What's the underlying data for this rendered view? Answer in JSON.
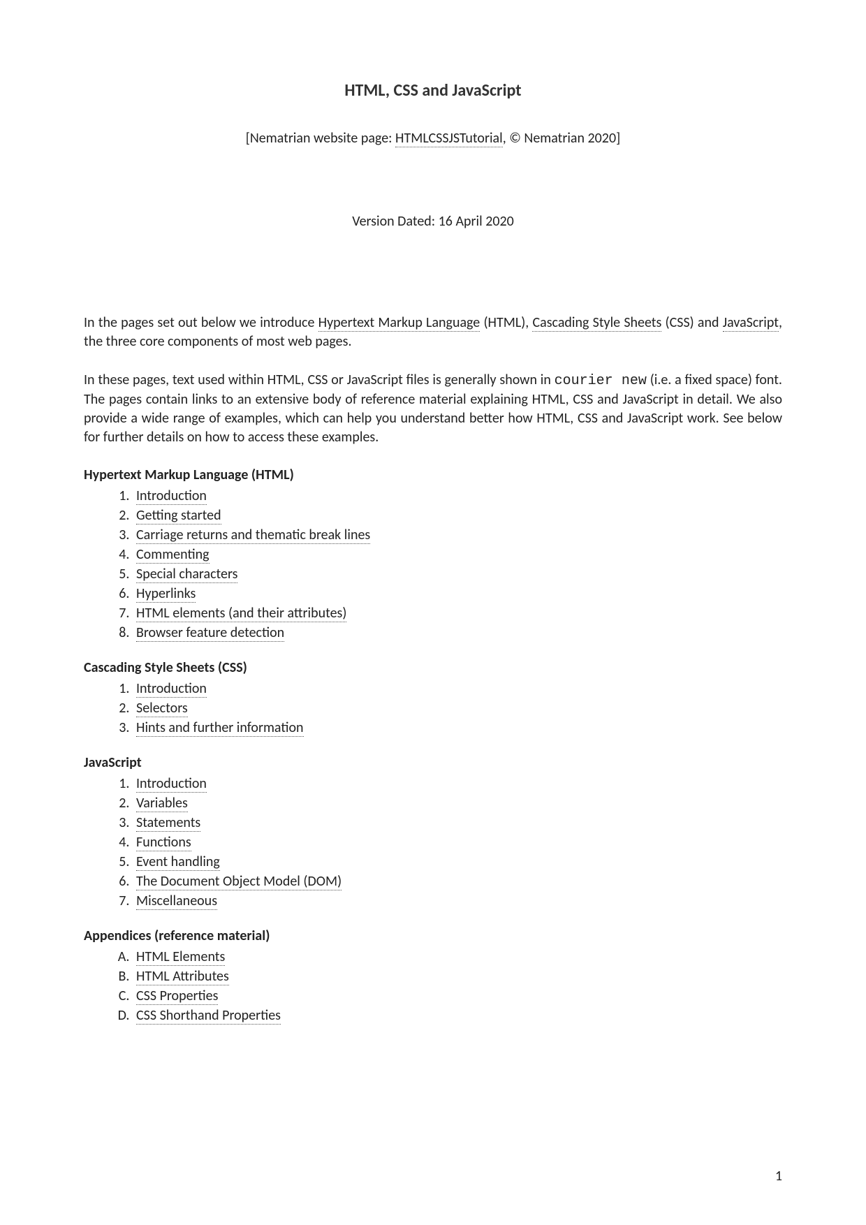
{
  "title": "HTML, CSS and JavaScript",
  "subtitle_prefix": "[Nematrian website page: ",
  "subtitle_link": "HTMLCSSJSTutorial",
  "subtitle_suffix": ", © Nematrian 2020]",
  "version_date": "Version Dated: 16 April  2020",
  "intro1_prefix": "In the pages set out below we introduce ",
  "intro1_link1": "Hypertext Markup Language",
  "intro1_mid1": " (HTML), ",
  "intro1_link2": "Cascading Style Sheets",
  "intro1_mid2": " (CSS) and ",
  "intro1_link3": "JavaScript",
  "intro1_suffix": ", the three core components of most web pages.",
  "intro2_prefix": "In these pages, text used within HTML, CSS or JavaScript files is generally shown in ",
  "intro2_mono": "courier new",
  "intro2_suffix": " (i.e. a fixed space) font. The pages contain links to an extensive body of reference material explaining HTML, CSS and JavaScript in detail. We also provide a wide range of examples, which can help you understand better how HTML, CSS and JavaScript work. See below for further details on how to access these examples.",
  "sections": {
    "html": {
      "heading": "Hypertext Markup Language (HTML)",
      "items": [
        "Introduction",
        "Getting started",
        "Carriage returns and thematic break lines",
        "Commenting",
        "Special characters",
        "Hyperlinks",
        "HTML elements (and their attributes)",
        "Browser feature detection"
      ]
    },
    "css": {
      "heading": "Cascading Style Sheets (CSS)",
      "items": [
        "Introduction",
        "Selectors",
        "Hints and further information"
      ]
    },
    "js": {
      "heading": "JavaScript",
      "items": [
        "Introduction",
        "Variables",
        "Statements",
        "Functions",
        "Event handling",
        "The Document Object Model (DOM)",
        "Miscellaneous"
      ]
    },
    "appendices": {
      "heading": "Appendices (reference material)",
      "items": [
        "HTML Elements",
        "HTML Attributes",
        "CSS Properties",
        "CSS Shorthand Properties"
      ]
    }
  },
  "page_number": "1"
}
